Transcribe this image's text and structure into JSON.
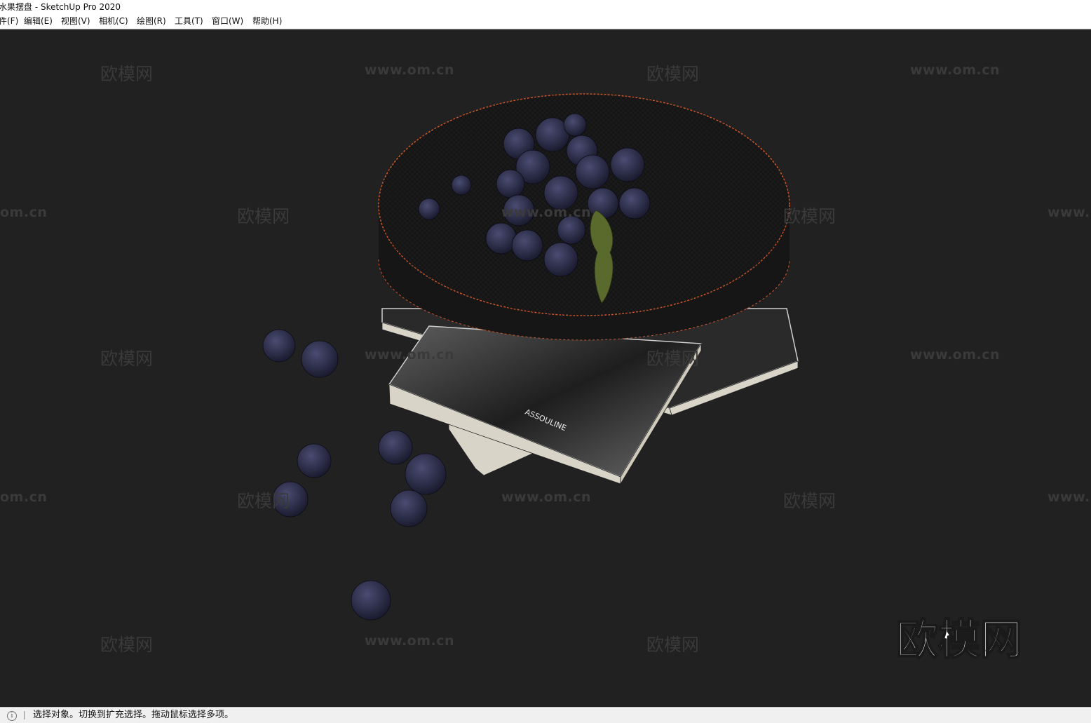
{
  "window": {
    "title": "水果摆盘 - SketchUp Pro 2020"
  },
  "menu": [
    {
      "id": "file",
      "label": "件(F)"
    },
    {
      "id": "edit",
      "label": "编辑(E)"
    },
    {
      "id": "view",
      "label": "视图(V)"
    },
    {
      "id": "camera",
      "label": "相机(C)"
    },
    {
      "id": "draw",
      "label": "绘图(R)"
    },
    {
      "id": "tools",
      "label": "工具(T)"
    },
    {
      "id": "window",
      "label": "窗口(W)"
    },
    {
      "id": "help",
      "label": "帮助(H)"
    }
  ],
  "viewport": {
    "book_text": "ASSOULINE",
    "watermark_cn": "欧模网",
    "watermark_url": "www.om.cn",
    "watermark_url_cut_left": "om.cn",
    "watermark_url_cut_right": "www.",
    "brand_logo": "欧模网"
  },
  "status": {
    "icon": "info-icon",
    "text": "选择对象。切换到扩充选择。拖动鼠标选择多项。"
  },
  "colors": {
    "viewport_bg": "#212121",
    "plate": "#1a1a1a",
    "plate_rim": "#d0582a",
    "blueberry": "#2b2d48",
    "book_page": "#d8d4c8",
    "watermark": "#3a3a3a"
  }
}
